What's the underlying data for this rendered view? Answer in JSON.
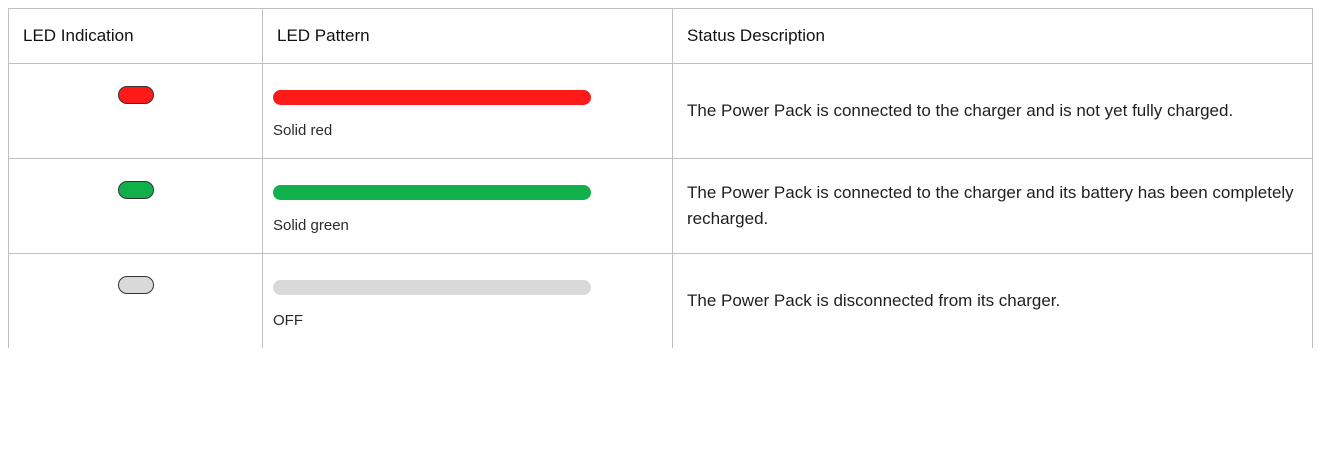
{
  "table": {
    "headers": [
      "LED Indication",
      "LED Pattern",
      "Status Description"
    ],
    "rows": [
      {
        "led_color": "#ff1a1a",
        "bar_color": "#ff1a1a",
        "pattern_label": "Solid red",
        "description": "The Power Pack is connected to the charger and is not yet fully charged."
      },
      {
        "led_color": "#12b04a",
        "bar_color": "#12b04a",
        "pattern_label": "Solid green",
        "description": "The Power Pack is connected to the charger and its battery has been completely recharged."
      },
      {
        "led_color": "#d9d9d9",
        "bar_color": "#d9d9d9",
        "pattern_label": "OFF",
        "description": "The Power Pack is disconnected from its charger."
      }
    ]
  }
}
